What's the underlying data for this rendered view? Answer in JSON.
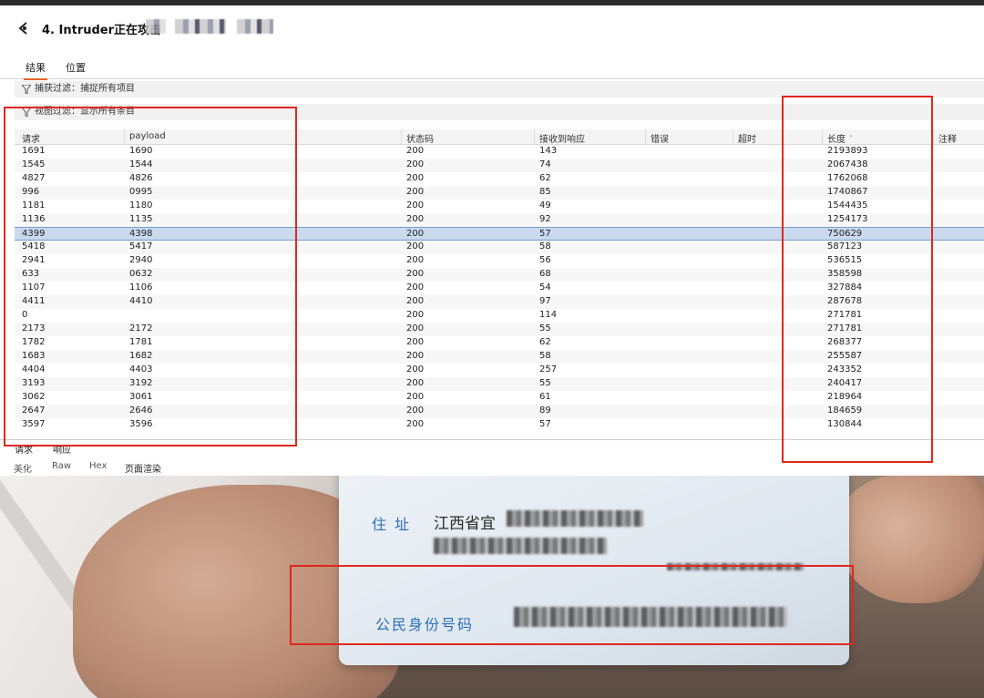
{
  "window": {
    "title": "4. Intruder正在攻击",
    "title_suffix_redacted": "htt"
  },
  "top_tabs": [
    "结果",
    "位置"
  ],
  "filters": {
    "capture": "捕获过滤：捕捉所有项目",
    "view": "视图过滤：显示所有条目"
  },
  "table": {
    "columns": [
      "请求",
      "payload",
      "状态码",
      "接收到响应",
      "错误",
      "超时",
      "长度",
      "注释"
    ],
    "sort_indicator": "˅",
    "rows": [
      {
        "req": "1691",
        "payload": "1690",
        "status": "200",
        "resp": "143",
        "len": "2193893"
      },
      {
        "req": "1545",
        "payload": "1544",
        "status": "200",
        "resp": "74",
        "len": "2067438"
      },
      {
        "req": "4827",
        "payload": "4826",
        "status": "200",
        "resp": "62",
        "len": "1762068"
      },
      {
        "req": "996",
        "payload": "0995",
        "status": "200",
        "resp": "85",
        "len": "1740867"
      },
      {
        "req": "1181",
        "payload": "1180",
        "status": "200",
        "resp": "49",
        "len": "1544435"
      },
      {
        "req": "1136",
        "payload": "1135",
        "status": "200",
        "resp": "92",
        "len": "1254173"
      },
      {
        "req": "4399",
        "payload": "4398",
        "status": "200",
        "resp": "57",
        "len": "750629",
        "selected": true
      },
      {
        "req": "5418",
        "payload": "5417",
        "status": "200",
        "resp": "58",
        "len": "587123"
      },
      {
        "req": "2941",
        "payload": "2940",
        "status": "200",
        "resp": "56",
        "len": "536515"
      },
      {
        "req": "633",
        "payload": "0632",
        "status": "200",
        "resp": "68",
        "len": "358598"
      },
      {
        "req": "1107",
        "payload": "1106",
        "status": "200",
        "resp": "54",
        "len": "327884"
      },
      {
        "req": "4411",
        "payload": "4410",
        "status": "200",
        "resp": "97",
        "len": "287678"
      },
      {
        "req": "0",
        "payload": "",
        "status": "200",
        "resp": "114",
        "len": "271781"
      },
      {
        "req": "2173",
        "payload": "2172",
        "status": "200",
        "resp": "55",
        "len": "271781"
      },
      {
        "req": "1782",
        "payload": "1781",
        "status": "200",
        "resp": "62",
        "len": "268377"
      },
      {
        "req": "1683",
        "payload": "1682",
        "status": "200",
        "resp": "58",
        "len": "255587"
      },
      {
        "req": "4404",
        "payload": "4403",
        "status": "200",
        "resp": "257",
        "len": "243352"
      },
      {
        "req": "3193",
        "payload": "3192",
        "status": "200",
        "resp": "55",
        "len": "240417"
      },
      {
        "req": "3062",
        "payload": "3061",
        "status": "200",
        "resp": "61",
        "len": "218964"
      },
      {
        "req": "2647",
        "payload": "2646",
        "status": "200",
        "resp": "89",
        "len": "184659"
      },
      {
        "req": "3597",
        "payload": "3596",
        "status": "200",
        "resp": "57",
        "len": "130844"
      }
    ]
  },
  "section_tabs": [
    "请求",
    "响应"
  ],
  "view_tabs": [
    "美化",
    "Raw",
    "Hex",
    "页面渲染"
  ],
  "id_card": {
    "address_label": "住 址",
    "address_text": "江西省宜",
    "id_label": "公民身份号码"
  },
  "colors": {
    "accent": "#e8642c",
    "annotation_red": "#e0281e",
    "selected_row": "#c9d9ee",
    "card_label_blue": "#2c6fb8"
  }
}
